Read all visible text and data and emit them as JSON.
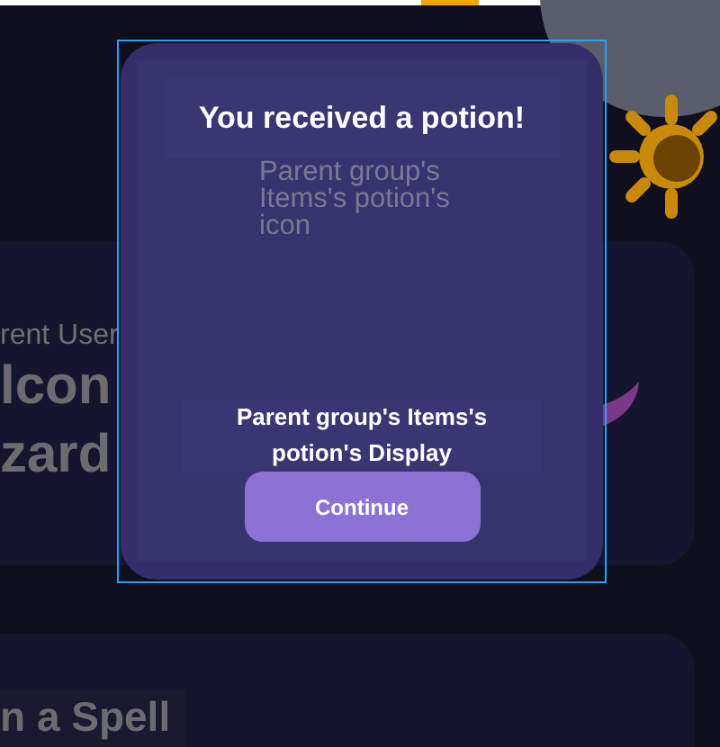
{
  "background_cards": [
    {
      "kind": "profile",
      "subtitle": "rent User",
      "title_lines": [
        "lcon",
        "zard"
      ]
    },
    {
      "kind": "action",
      "title": "n a Spell"
    }
  ],
  "modal": {
    "title": "You received a potion!",
    "icon_label": "Parent group's Items's potion's icon",
    "display_label": "Parent group's Items's potion's Display",
    "button": "Continue"
  }
}
